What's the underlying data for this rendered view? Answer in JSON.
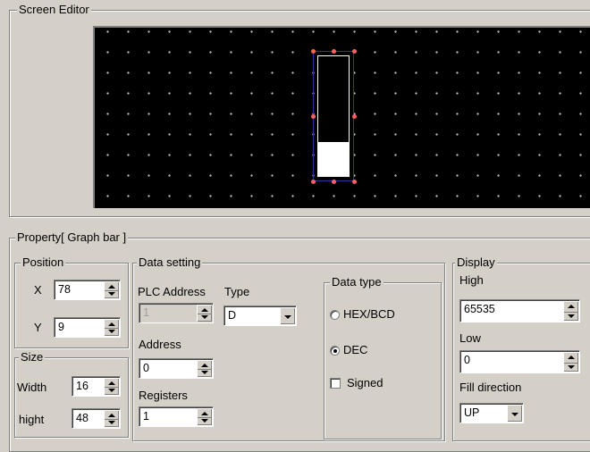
{
  "screen_editor": {
    "title": "Screen Editor"
  },
  "property": {
    "title": "Property[ Graph bar ]",
    "position": {
      "title": "Position",
      "x_label": "X",
      "x_value": "78",
      "y_label": "Y",
      "y_value": "9"
    },
    "size": {
      "title": "Size",
      "width_label": "Width",
      "width_value": "16",
      "height_label": "hight",
      "height_value": "48"
    },
    "data_setting": {
      "title": "Data setting",
      "plc_address_label": "PLC Address",
      "plc_address_value": "1",
      "type_label": "Type",
      "type_value": "D",
      "address_label": "Address",
      "address_value": "0",
      "registers_label": "Registers",
      "registers_value": "1"
    },
    "data_type": {
      "title": "Data type",
      "options": [
        {
          "label": "HEX/BCD",
          "selected": false
        },
        {
          "label": "DEC",
          "selected": true
        }
      ],
      "signed_label": "Signed",
      "signed_checked": false
    },
    "display": {
      "title": "Display",
      "high_label": "High",
      "high_value": "65535",
      "low_label": "Low",
      "low_value": "0",
      "fill_direction_label": "Fill direction",
      "fill_direction_value": "UP"
    }
  },
  "graph_bar": {
    "fill_level": 0.28
  },
  "colors": {
    "selection_outline": "#3030a0",
    "handle": "#ff6060",
    "canvas": "#000000",
    "dot": "#bfbfbf"
  }
}
